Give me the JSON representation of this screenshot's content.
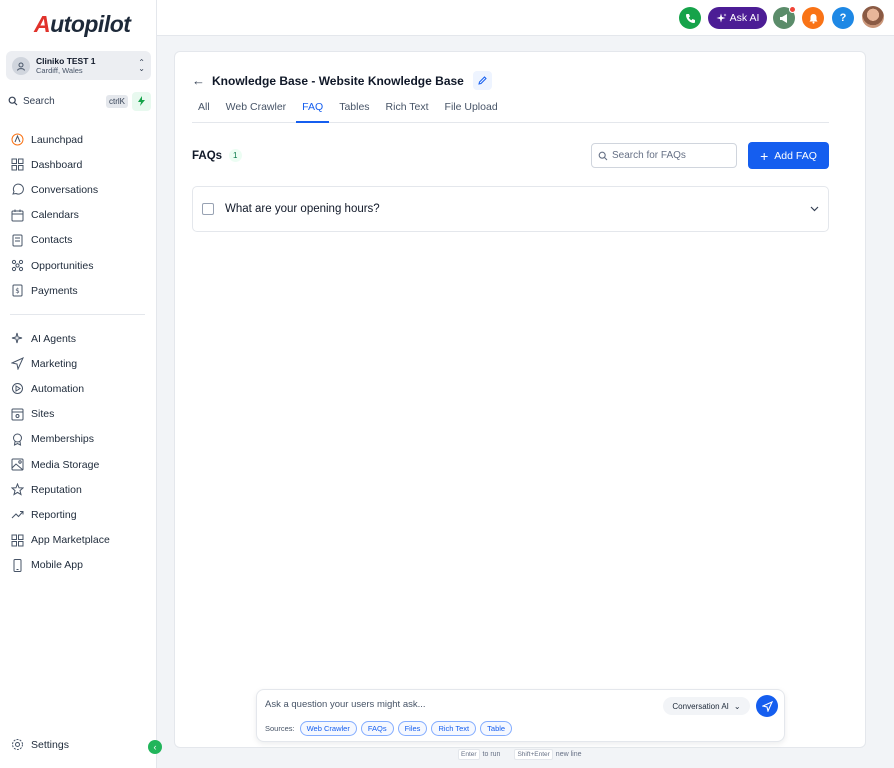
{
  "app": {
    "logo_text": "Autopilot",
    "logo_a": "A",
    "logo_rest": "utopilot"
  },
  "location": {
    "name": "Cliniko TEST 1",
    "sub": "Cardiff, Wales"
  },
  "search": {
    "label": "Search",
    "shortcut": "ctrlK"
  },
  "nav_main": [
    {
      "label": "Launchpad",
      "icon": "launchpad-icon"
    },
    {
      "label": "Dashboard",
      "icon": "dashboard-icon"
    },
    {
      "label": "Conversations",
      "icon": "chat-icon"
    },
    {
      "label": "Calendars",
      "icon": "calendar-icon"
    },
    {
      "label": "Contacts",
      "icon": "contacts-icon"
    },
    {
      "label": "Opportunities",
      "icon": "opportunities-icon"
    },
    {
      "label": "Payments",
      "icon": "payments-icon"
    }
  ],
  "nav_secondary": [
    {
      "label": "AI Agents",
      "icon": "sparkle-icon"
    },
    {
      "label": "Marketing",
      "icon": "send-icon"
    },
    {
      "label": "Automation",
      "icon": "automation-icon"
    },
    {
      "label": "Sites",
      "icon": "sites-icon"
    },
    {
      "label": "Memberships",
      "icon": "membership-icon"
    },
    {
      "label": "Media Storage",
      "icon": "image-icon"
    },
    {
      "label": "Reputation",
      "icon": "star-icon"
    },
    {
      "label": "Reporting",
      "icon": "trend-icon"
    },
    {
      "label": "App Marketplace",
      "icon": "grid-icon"
    },
    {
      "label": "Mobile App",
      "icon": "mobile-icon"
    }
  ],
  "settings": {
    "label": "Settings"
  },
  "topbar": {
    "ask_ai": "Ask AI",
    "help": "?"
  },
  "page": {
    "title": "Knowledge Base - Website Knowledge Base",
    "tabs": [
      {
        "label": "All",
        "active": false
      },
      {
        "label": "Web Crawler",
        "active": false
      },
      {
        "label": "FAQ",
        "active": true
      },
      {
        "label": "Tables",
        "active": false
      },
      {
        "label": "Rich Text",
        "active": false
      },
      {
        "label": "File Upload",
        "active": false
      }
    ],
    "faq_title": "FAQs",
    "faq_count": "1",
    "faq_search_placeholder": "Search for FAQs",
    "add_button": "Add FAQ",
    "faqs": [
      {
        "question": "What are your opening hours?"
      }
    ]
  },
  "chat": {
    "placeholder": "Ask a question your users might ask...",
    "mode": "Conversation AI",
    "sources_label": "Sources:",
    "sources": [
      "Web Crawler",
      "FAQs",
      "Files",
      "Rich Text",
      "Table"
    ],
    "hint_enter_key": "Enter",
    "hint_enter_text": "to run",
    "hint_shift_key": "Shift+Enter",
    "hint_shift_text": "new line"
  },
  "colors": {
    "primary": "#155eef",
    "ask_ai": "#4c1d95",
    "phone": "#16a34a",
    "notify": "#f97316",
    "help": "#1e88e5",
    "accent_green": "#22b55b"
  }
}
